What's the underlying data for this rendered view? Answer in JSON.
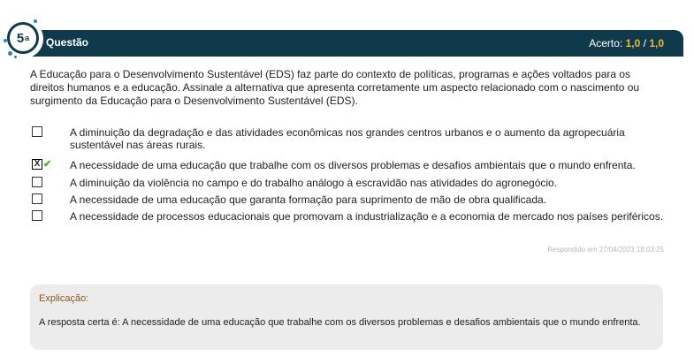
{
  "header": {
    "number": "5",
    "ordinal": "a",
    "title": "Questão",
    "score_label": "Acerto:",
    "score_value": "1,0",
    "score_sep": "/",
    "score_total": "1,0",
    "colors": {
      "bar": "#0f3a4c",
      "score": "#f6b928"
    }
  },
  "question": {
    "text": "A Educação para o Desenvolvimento Sustentável (EDS) faz parte do contexto de políticas, programas e ações voltados para os direitos humanos e a educação. Assinale a alternativa que apresenta corretamente um aspecto relacionado com o nascimento ou surgimento da Educação para o Desenvolvimento Sustentável (EDS)."
  },
  "options": [
    {
      "text": "A diminuição da degradação e das atividades econômicas nos grandes centros urbanos e o aumento da agropecuária sustentável nas áreas rurais.",
      "selected": false
    },
    {
      "text": "A necessidade de uma educação que trabalhe com os diversos problemas e desafios ambientais que o mundo enfrenta.",
      "selected": true,
      "mark": "X",
      "correct_icon": "check-icon"
    },
    {
      "text": "A diminuição da violência no campo e do trabalho análogo à escravidão nas atividades do agronegócio.",
      "selected": false
    },
    {
      "text": "A necessidade de uma educação que garanta formação para suprimento de mão de obra qualificada.",
      "selected": false
    },
    {
      "text": "A necessidade de processos educacionais que promovam a industrialização e a economia de mercado nos países periféricos.",
      "selected": false
    }
  ],
  "answered_at": "Respondido em 27/04/2023 18:03:25",
  "explanation": {
    "title": "Explicação:",
    "text": "A resposta certa é: A necessidade de uma educação que trabalhe com os diversos problemas e desafios ambientais que o mundo enfrenta."
  }
}
